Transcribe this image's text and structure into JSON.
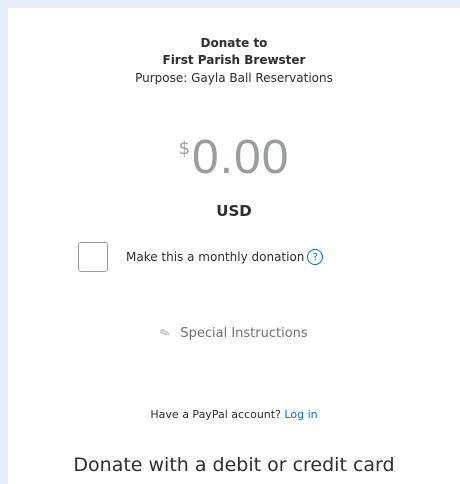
{
  "header": {
    "donate_to": "Donate to",
    "org_name": "First Parish Brewster",
    "purpose": "Purpose: Gayla Ball Reservations"
  },
  "amount": {
    "currency_symbol": "$",
    "value": "0.00",
    "currency_code": "USD"
  },
  "monthly": {
    "label": "Make this a monthly donation",
    "checked": false,
    "help_icon": "?"
  },
  "special_instructions": {
    "icon": "pencil-icon",
    "label": "Special Instructions"
  },
  "paypal": {
    "prompt": "Have a PayPal account?",
    "login_label": "Log in"
  },
  "card_section": {
    "title": "Donate with a debit or credit card"
  },
  "colors": {
    "link": "#0070ba",
    "text": "#2c2e2f",
    "muted": "#9a9da0",
    "background": "#e6eef8"
  }
}
